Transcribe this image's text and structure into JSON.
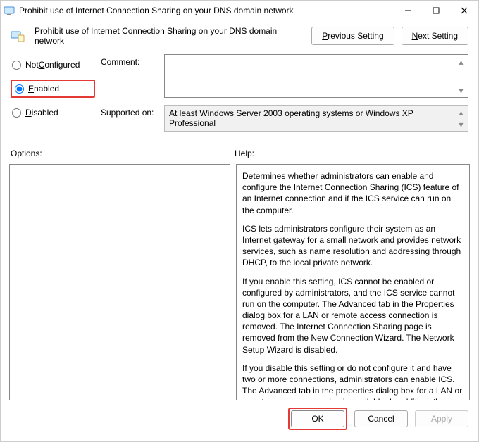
{
  "titlebar": {
    "text": "Prohibit use of Internet Connection Sharing on your DNS domain network"
  },
  "header": {
    "title": "Prohibit use of Internet Connection Sharing on your DNS domain network",
    "previous_setting": "revious Setting",
    "previous_prefix": "P",
    "next_setting": "ext Setting",
    "next_prefix": "N"
  },
  "radios": {
    "not_configured": "Not ",
    "not_configured_u": "C",
    "not_configured_suffix": "onfigured",
    "enabled_u": "E",
    "enabled_suffix": "nabled",
    "disabled_u": "D",
    "disabled_suffix": "isabled"
  },
  "fields": {
    "comment_label": "Comment:",
    "supported_label": "Supported on:",
    "supported_text": "At least Windows Server 2003 operating systems or Windows XP Professional"
  },
  "labels": {
    "options": "Options:",
    "help": "Help:"
  },
  "help": {
    "p1": "Determines whether administrators can enable and configure the Internet Connection Sharing (ICS) feature of an Internet connection and if the ICS service can run on the computer.",
    "p2": "ICS lets administrators configure their system as an Internet gateway for a small network and provides network services, such as name resolution and addressing through DHCP, to the local private network.",
    "p3": "If you enable this setting, ICS cannot be enabled or configured by administrators, and the ICS service cannot run on the computer. The Advanced tab in the Properties dialog box for a LAN or remote access connection is removed. The Internet Connection Sharing page is removed from the New Connection Wizard. The Network Setup Wizard is disabled.",
    "p4": "If you disable this setting or do not configure it and have two or more connections, administrators can enable ICS. The Advanced tab in the properties dialog box for a LAN or remote access connection is available. In addition, the user is presented with the option to enable Internet Connection Sharing in the Network"
  },
  "footer": {
    "ok": "OK",
    "cancel": "Cancel",
    "apply": "Apply"
  }
}
